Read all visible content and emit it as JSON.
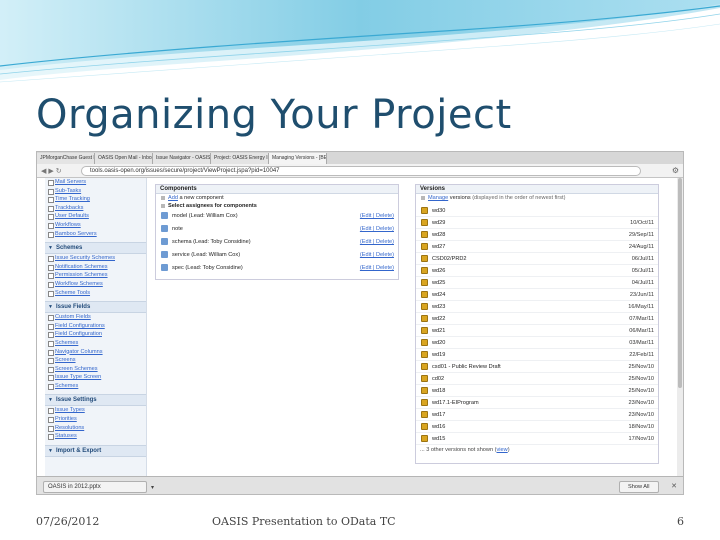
{
  "slide": {
    "title": "Organizing Your Project",
    "footer_date": "07/26/2012",
    "footer_center": "OASIS Presentation to OData TC",
    "page_number": "6",
    "accent_color": "#1f4e6e"
  },
  "browser": {
    "tabs": [
      {
        "label": "JPMorganChase Guest Netw"
      },
      {
        "label": "OASIS Open Mail - Inbox (1"
      },
      {
        "label": "Issue Navigator - OASIS Iss"
      },
      {
        "label": "Project: OASIS Energy Inter"
      },
      {
        "label": "Managing Versions - [BETA"
      }
    ],
    "url": "tools.oasis-open.org/issues/secure/project/ViewProject.jspa?pid=10047",
    "nav_icons": [
      "back-icon",
      "forward-icon",
      "reload-icon"
    ]
  },
  "sidebar": {
    "top_items": [
      {
        "label": "Mail Servers"
      },
      {
        "label": "Sub-Tasks"
      },
      {
        "label": "Time Tracking"
      },
      {
        "label": "Trackbacks"
      },
      {
        "label": "User Defaults"
      },
      {
        "label": "Workflows"
      },
      {
        "label": "Bamboo Servers"
      }
    ],
    "sections": [
      {
        "title": "Schemes",
        "items": [
          {
            "label": "Issue Security Schemes"
          },
          {
            "label": "Notification Schemes"
          },
          {
            "label": "Permission Schemes"
          },
          {
            "label": "Workflow Schemes"
          },
          {
            "label": "Scheme Tools"
          }
        ]
      },
      {
        "title": "Issue Fields",
        "items": [
          {
            "label": "Custom Fields"
          },
          {
            "label": "Field Configurations"
          },
          {
            "label": "Field Configuration"
          },
          {
            "label": "Schemes"
          },
          {
            "label": "Navigator Columns"
          },
          {
            "label": "Screens"
          },
          {
            "label": "Screen Schemes"
          },
          {
            "label": "Issue Type Screen"
          },
          {
            "label": "Schemes"
          }
        ]
      },
      {
        "title": "Issue Settings",
        "items": [
          {
            "label": "Issue Types"
          },
          {
            "label": "Priorities"
          },
          {
            "label": "Resolutions"
          },
          {
            "label": "Statuses"
          }
        ]
      },
      {
        "title": "Import & Export",
        "items": []
      }
    ]
  },
  "components": {
    "header": "Components",
    "actions": [
      {
        "link": "Add",
        "rest": "a new component"
      },
      {
        "bold": "Select assignees for components"
      }
    ],
    "items": [
      {
        "name": "model (Lead: William Cox)",
        "actions": "(Edit | Delete)"
      },
      {
        "name": "note",
        "actions": "(Edit | Delete)"
      },
      {
        "name": "schema (Lead: Toby Considine)",
        "actions": "(Edit | Delete)"
      },
      {
        "name": "service (Lead: William Cox)",
        "actions": "(Edit | Delete)"
      },
      {
        "name": "spec (Lead: Toby Considine)",
        "actions": "(Edit | Delete)"
      }
    ]
  },
  "versions": {
    "header": "Versions",
    "manage_link": "Manage",
    "manage_rest": "versions",
    "manage_note": "(displayed in the order of newest first)",
    "items": [
      {
        "name": "wd30",
        "date": ""
      },
      {
        "name": "wd29",
        "date": "10/Oct/11"
      },
      {
        "name": "wd28",
        "date": "29/Sep/11"
      },
      {
        "name": "wd27",
        "date": "24/Aug/11"
      },
      {
        "name": "CSD02/PRD2",
        "date": "06/Jul/11"
      },
      {
        "name": "wd26",
        "date": "05/Jul/11"
      },
      {
        "name": "wd25",
        "date": "04/Jul/11"
      },
      {
        "name": "wd24",
        "date": "23/Jun/11"
      },
      {
        "name": "wd23",
        "date": "16/May/11"
      },
      {
        "name": "wd22",
        "date": "07/Mar/11"
      },
      {
        "name": "wd21",
        "date": "06/Mar/11"
      },
      {
        "name": "wd20",
        "date": "03/Mar/11"
      },
      {
        "name": "wd19",
        "date": "22/Feb/11"
      },
      {
        "name": "csd01 - Public Review Draft",
        "date": "25/Nov/10"
      },
      {
        "name": "cd02",
        "date": "25/Nov/10"
      },
      {
        "name": "wd18",
        "date": "25/Nov/10"
      },
      {
        "name": "wd17.1-EIProgram",
        "date": "23/Nov/10"
      },
      {
        "name": "wd17",
        "date": "23/Nov/10"
      },
      {
        "name": "wd16",
        "date": "18/Nov/10"
      },
      {
        "name": "wd15",
        "date": "17/Nov/10"
      }
    ],
    "more_text": "... 3 other versions not shown (",
    "more_link": "view",
    "more_end": ")"
  },
  "downloads": {
    "file": "OASIS in 2012.pptx",
    "show_all": "Show All"
  }
}
